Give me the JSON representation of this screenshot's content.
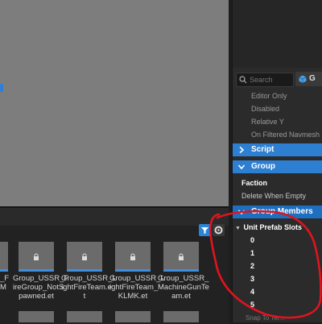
{
  "viewport": {},
  "browser": {
    "tiles": [
      {
        "label": "_F\nM",
        "partial": true
      },
      {
        "label": "Group_USSR_F\nireGroup_NotS\npawned.et",
        "partial": false
      },
      {
        "label": "Group_USSR_L\nightFireTeam.e\nt",
        "partial": false
      },
      {
        "label": "Group_USSR_L\nightFireTeam_\nKLMK.et",
        "partial": false
      },
      {
        "label": "Group_USSR_\nMachineGunTe\nam.et",
        "partial": false
      }
    ]
  },
  "right_panel": {
    "search_placeholder": "Search",
    "cube_letter": "G",
    "properties_top": [
      "Editor Only",
      "Disabled",
      "Relative Y",
      "On Filtered Navmesh"
    ],
    "sections": {
      "script": "Script",
      "group": "Group",
      "group_members": "Group Members"
    },
    "faction": "Faction",
    "delete_when_empty": "Delete When Empty",
    "unit_prefab_slots": "Unit Prefab Slots",
    "slots": [
      "0",
      "1",
      "2",
      "3",
      "4",
      "5"
    ],
    "cut_text": "Snap To Ter..."
  },
  "colors": {
    "accent": "#2d7fd2",
    "annotation": "#e0141e"
  }
}
